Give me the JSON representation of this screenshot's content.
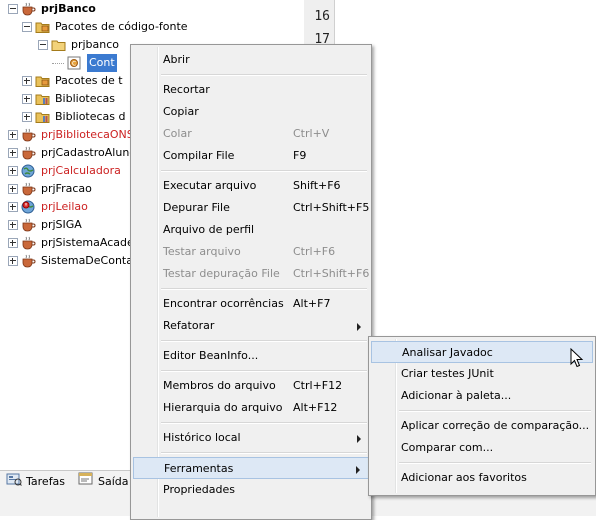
{
  "tree": {
    "items": [
      {
        "label": "prjBanco",
        "bold": true,
        "red": false,
        "icon": "coffee-cup-icon",
        "level": 1,
        "expander": "minus"
      },
      {
        "label": "Pacotes de código-fonte",
        "bold": false,
        "red": false,
        "icon": "package-folder-icon",
        "level": 2,
        "expander": "minus"
      },
      {
        "label": "prjbanco",
        "bold": false,
        "red": false,
        "icon": "package-icon",
        "level": 3,
        "expander": "minus"
      },
      {
        "label": "Cont",
        "bold": false,
        "red": false,
        "icon": "java-class-icon",
        "level": 4,
        "expander": "none",
        "selected": true
      },
      {
        "label": "Pacotes de t",
        "bold": false,
        "red": false,
        "icon": "package-folder-icon",
        "level": 2,
        "expander": "plus"
      },
      {
        "label": "Bibliotecas",
        "bold": false,
        "red": false,
        "icon": "library-icon",
        "level": 2,
        "expander": "plus"
      },
      {
        "label": "Bibliotecas d",
        "bold": false,
        "red": false,
        "icon": "library-icon",
        "level": 2,
        "expander": "plus"
      },
      {
        "label": "prjBibliotecaONS",
        "bold": false,
        "red": true,
        "icon": "coffee-cup-icon",
        "level": 1,
        "expander": "plus"
      },
      {
        "label": "prjCadastroAluno",
        "bold": false,
        "red": false,
        "icon": "coffee-cup-icon",
        "level": 1,
        "expander": "plus"
      },
      {
        "label": "prjCalculadora",
        "bold": false,
        "red": true,
        "icon": "globe-icon",
        "level": 1,
        "expander": "plus"
      },
      {
        "label": "prjFracao",
        "bold": false,
        "red": false,
        "icon": "coffee-cup-icon",
        "level": 1,
        "expander": "plus"
      },
      {
        "label": "prjLeilao",
        "bold": false,
        "red": true,
        "icon": "warning-globe-icon",
        "level": 1,
        "expander": "plus"
      },
      {
        "label": "prjSIGA",
        "bold": false,
        "red": false,
        "icon": "coffee-cup-icon",
        "level": 1,
        "expander": "plus"
      },
      {
        "label": "prjSistemaAcade",
        "bold": false,
        "red": false,
        "icon": "coffee-cup-icon",
        "level": 1,
        "expander": "plus"
      },
      {
        "label": "SistemaDeConta",
        "bold": false,
        "red": false,
        "icon": "coffee-cup-icon",
        "level": 1,
        "expander": "plus"
      }
    ]
  },
  "editor": {
    "line_numbers": [
      "16",
      "17"
    ]
  },
  "bottom_tabs": [
    {
      "label": "Tarefas",
      "icon": "tasks-icon"
    },
    {
      "label": "Saída",
      "icon": "output-icon"
    }
  ],
  "context_menu": {
    "items": [
      {
        "label": "Abrir",
        "shortcut": "",
        "disabled": false
      },
      {
        "sep": true
      },
      {
        "label": "Recortar",
        "shortcut": "",
        "disabled": false
      },
      {
        "label": "Copiar",
        "shortcut": "",
        "disabled": false
      },
      {
        "label": "Colar",
        "shortcut": "Ctrl+V",
        "disabled": true
      },
      {
        "label": "Compilar File",
        "shortcut": "F9",
        "disabled": false
      },
      {
        "sep": true
      },
      {
        "label": "Executar arquivo",
        "shortcut": "Shift+F6",
        "disabled": false
      },
      {
        "label": "Depurar File",
        "shortcut": "Ctrl+Shift+F5",
        "disabled": false
      },
      {
        "label": "Arquivo de perfil",
        "shortcut": "",
        "disabled": false
      },
      {
        "label": "Testar arquivo",
        "shortcut": "Ctrl+F6",
        "disabled": true
      },
      {
        "label": "Testar depuração File",
        "shortcut": "Ctrl+Shift+F6",
        "disabled": true
      },
      {
        "sep": true
      },
      {
        "label": "Encontrar ocorrências",
        "shortcut": "Alt+F7",
        "disabled": false
      },
      {
        "label": "Refatorar",
        "shortcut": "",
        "disabled": false,
        "submenu": true
      },
      {
        "sep": true
      },
      {
        "label": "Editor BeanInfo...",
        "shortcut": "",
        "disabled": false
      },
      {
        "sep": true
      },
      {
        "label": "Membros do arquivo",
        "shortcut": "Ctrl+F12",
        "disabled": false
      },
      {
        "label": "Hierarquia do arquivo",
        "shortcut": "Alt+F12",
        "disabled": false
      },
      {
        "sep": true
      },
      {
        "label": "Histórico local",
        "shortcut": "",
        "disabled": false,
        "submenu": true
      },
      {
        "sep": true
      },
      {
        "label": "Ferramentas",
        "shortcut": "",
        "disabled": false,
        "submenu": true,
        "highlighted": true
      },
      {
        "label": "Propriedades",
        "shortcut": "",
        "disabled": false
      }
    ]
  },
  "submenu": {
    "items": [
      {
        "label": "Analisar Javadoc",
        "highlighted": true
      },
      {
        "label": "Criar testes JUnit"
      },
      {
        "label": "Adicionar à paleta..."
      },
      {
        "sep": true
      },
      {
        "label": "Aplicar correção de comparação..."
      },
      {
        "label": "Comparar com..."
      },
      {
        "sep": true
      },
      {
        "label": "Adicionar aos favoritos"
      }
    ]
  }
}
